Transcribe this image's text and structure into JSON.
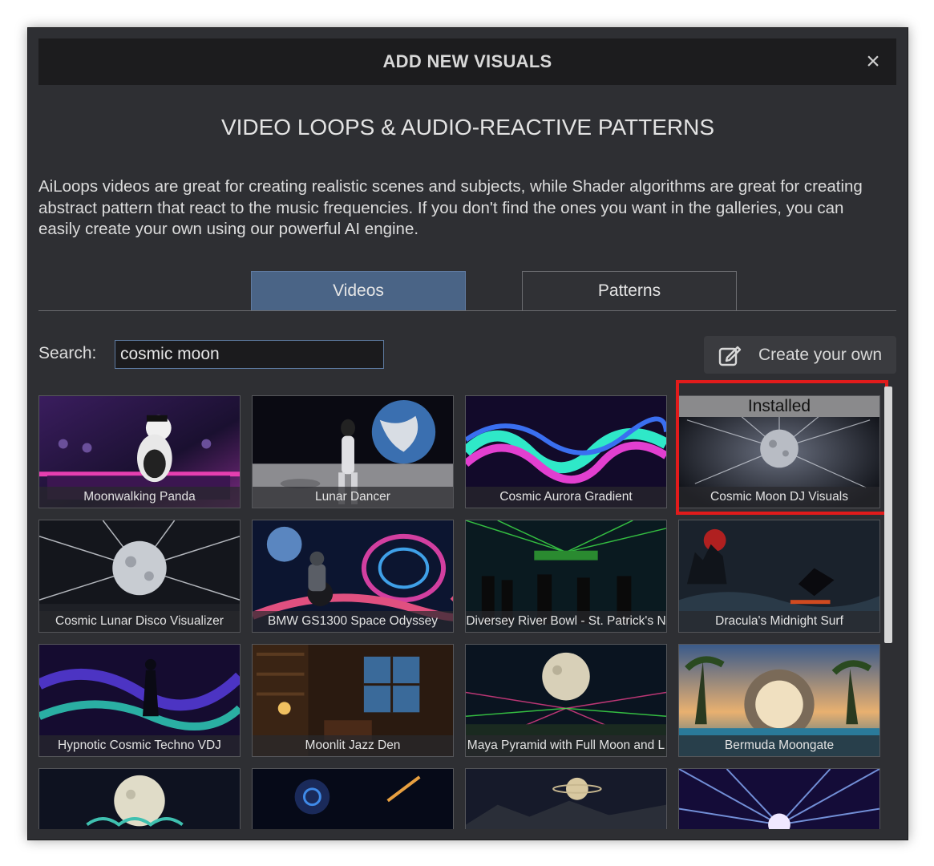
{
  "dialog": {
    "title": "ADD NEW VISUALS",
    "close_symbol": "×",
    "heading": "VIDEO LOOPS & AUDIO-REACTIVE PATTERNS",
    "description": "AiLoops videos are great for creating realistic scenes and subjects, while Shader algorithms are great for creating abstract pattern that react to the music frequencies. If you don't find the ones you want in the galleries, you can easily create your own using our powerful AI engine."
  },
  "tabs": [
    {
      "label": "Videos",
      "active": true
    },
    {
      "label": "Patterns",
      "active": false
    }
  ],
  "search": {
    "label": "Search:",
    "value": "cosmic moon"
  },
  "create_button": {
    "label": "Create your own",
    "icon": "edit-icon"
  },
  "gallery": {
    "items": [
      {
        "title": "Moonwalking Panda",
        "installed": false
      },
      {
        "title": "Lunar Dancer",
        "installed": false
      },
      {
        "title": "Cosmic Aurora Gradient",
        "installed": false
      },
      {
        "title": "Cosmic Moon DJ Visuals",
        "installed": true,
        "badge": "Installed"
      },
      {
        "title": "Cosmic Lunar Disco Visualizer",
        "installed": false
      },
      {
        "title": "BMW GS1300 Space Odyssey",
        "installed": false
      },
      {
        "title": "Diversey River Bowl - St. Patrick's N",
        "installed": false
      },
      {
        "title": "Dracula's Midnight Surf",
        "installed": false
      },
      {
        "title": "Hypnotic Cosmic Techno VDJ",
        "installed": false
      },
      {
        "title": "Moonlit Jazz Den",
        "installed": false
      },
      {
        "title": "Maya Pyramid with Full Moon and L",
        "installed": false
      },
      {
        "title": "Bermuda Moongate",
        "installed": false
      },
      {
        "title": "",
        "installed": false
      },
      {
        "title": "",
        "installed": false
      },
      {
        "title": "",
        "installed": false
      },
      {
        "title": "",
        "installed": false
      }
    ]
  },
  "colors": {
    "dialog_bg": "#2e2f33",
    "active_tab": "#4a6486",
    "highlight": "#e21b1b"
  }
}
